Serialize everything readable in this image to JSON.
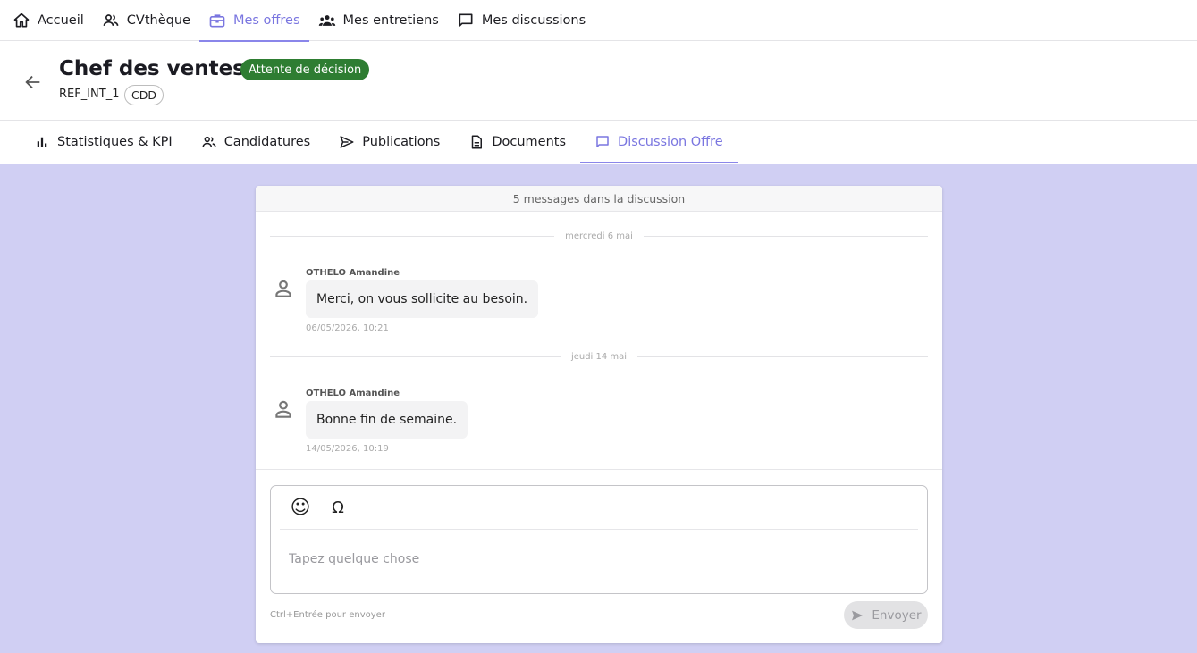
{
  "nav": {
    "items": [
      {
        "label": "Accueil",
        "icon": "home-icon"
      },
      {
        "label": "CVthèque",
        "icon": "people-icon"
      },
      {
        "label": "Mes offres",
        "icon": "briefcase-icon",
        "active": true
      },
      {
        "label": "Mes entretiens",
        "icon": "groups-icon"
      },
      {
        "label": "Mes discussions",
        "icon": "chat-icon"
      }
    ]
  },
  "header": {
    "title": "Chef des ventes",
    "status": "Attente de décision",
    "reference": "REF_INT_1",
    "contract": "CDD"
  },
  "tabs": [
    {
      "label": "Statistiques & KPI",
      "icon": "bar-chart-icon"
    },
    {
      "label": "Candidatures",
      "icon": "people-icon"
    },
    {
      "label": "Publications",
      "icon": "send-icon"
    },
    {
      "label": "Documents",
      "icon": "document-icon"
    },
    {
      "label": "Discussion Offre",
      "icon": "chat-icon",
      "active": true
    }
  ],
  "discussion": {
    "count_label": "5 messages dans la discussion",
    "separators": [
      "mercredi 6 mai",
      "jeudi 14 mai"
    ],
    "messages": [
      {
        "author": "OTHELO Amandine",
        "text": "Merci, on vous sollicite au besoin.",
        "time": "06/05/2026, 10:21"
      },
      {
        "author": "OTHELO Amandine",
        "text": "Bonne fin de semaine.",
        "time": "14/05/2026, 10:19"
      }
    ]
  },
  "composer": {
    "emoji_icon": "☺",
    "special_char_icon": "Ω",
    "placeholder": "Tapez quelque chose",
    "value": "",
    "hint": "Ctrl+Entrée pour envoyer",
    "send_label": "Envoyer"
  },
  "colors": {
    "accent": "#7a76e0",
    "status_green": "#2e7d32",
    "background_lavender": "#d0cff3"
  }
}
